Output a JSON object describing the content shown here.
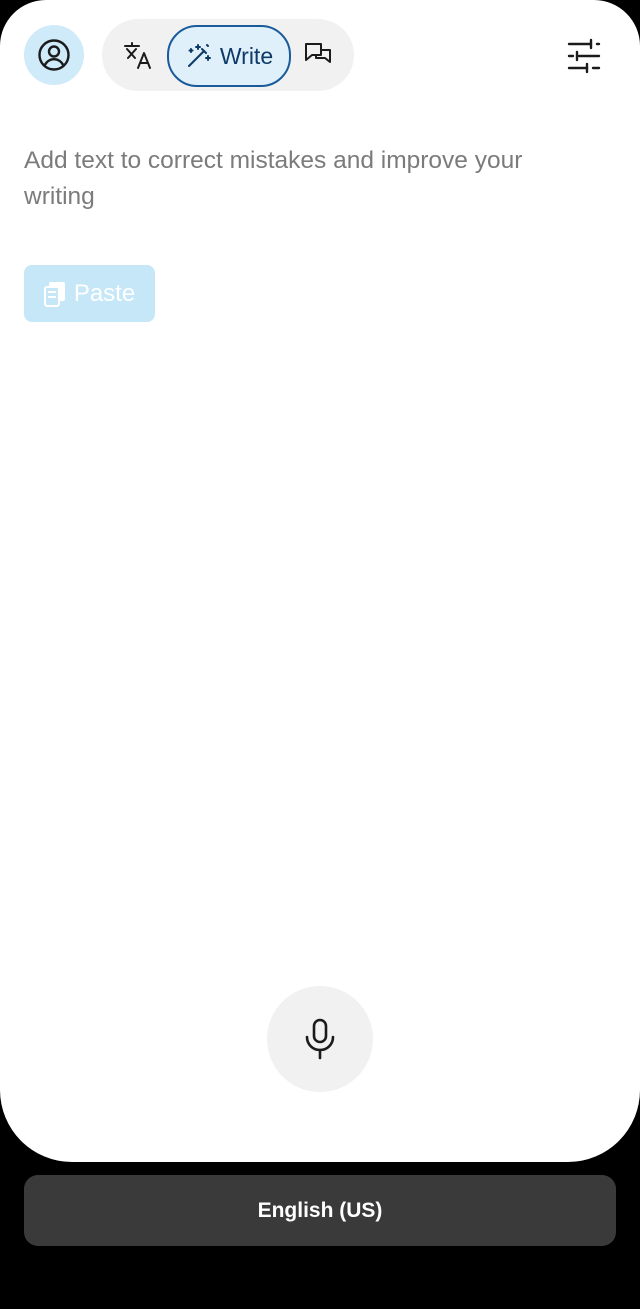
{
  "header": {
    "avatar_icon": "user-circle-icon",
    "modes": [
      {
        "id": "translate",
        "icon": "translate-icon",
        "label": ""
      },
      {
        "id": "write",
        "icon": "magic-wand-icon",
        "label": "Write",
        "selected": true
      },
      {
        "id": "chat",
        "icon": "chat-bubbles-icon",
        "label": ""
      }
    ],
    "settings_icon": "sliders-icon"
  },
  "editor": {
    "placeholder": "Add text to correct mistakes and improve your writing",
    "paste_label": "Paste",
    "paste_icon": "clipboard-icon"
  },
  "footer": {
    "mic_icon": "microphone-icon",
    "language_label": "English (US)"
  },
  "colors": {
    "accent_light": "#cfeaf9",
    "accent_border": "#1a5b9a",
    "paste_bg": "#c6e7f8",
    "language_bar_bg": "#3a3a3a"
  }
}
